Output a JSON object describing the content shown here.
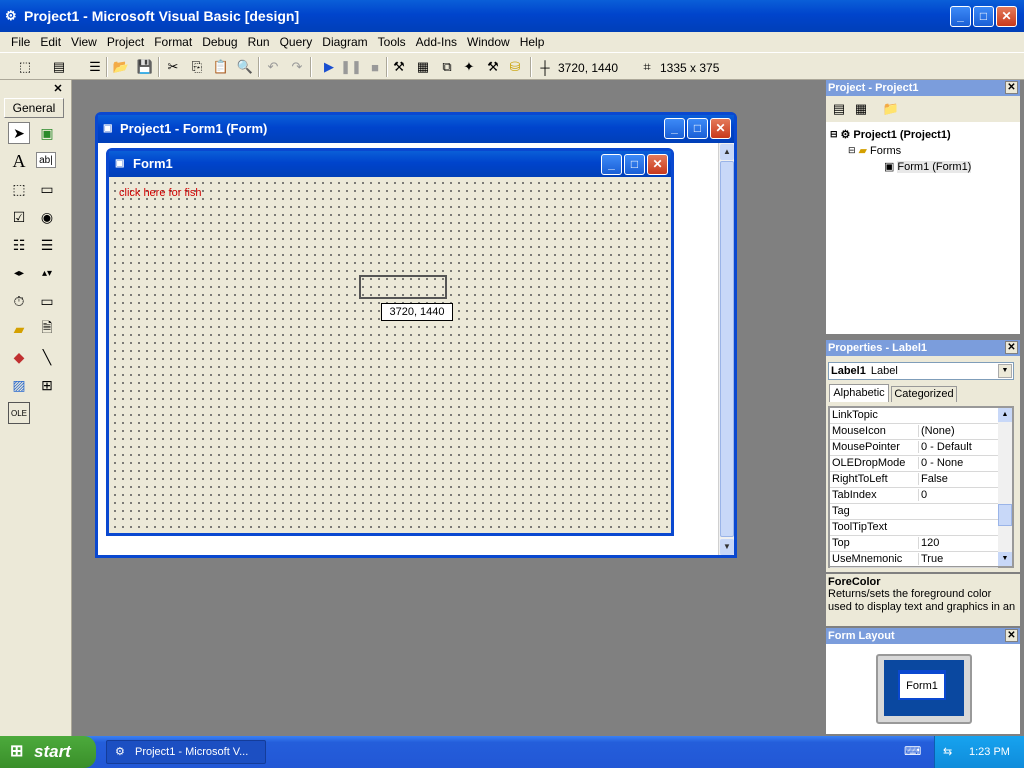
{
  "window": {
    "title": "Project1 - Microsoft Visual Basic [design]"
  },
  "menu": [
    "File",
    "Edit",
    "View",
    "Project",
    "Format",
    "Debug",
    "Run",
    "Query",
    "Diagram",
    "Tools",
    "Add-Ins",
    "Window",
    "Help"
  ],
  "toolbar": {
    "position_readout": "3720, 1440",
    "size_readout": "1335 x 375"
  },
  "toolbox": {
    "tab_label": "General",
    "close_glyph": "✕"
  },
  "designer": {
    "title": "Project1 - Form1 (Form)"
  },
  "form": {
    "title": "Form1",
    "label_text": "click here for fish",
    "label_color": "#d00000",
    "tooltip": "3720, 1440"
  },
  "project_pane": {
    "title": "Project - Project1",
    "tree": {
      "project": "Project1 (Project1)",
      "folder": "Forms",
      "form": "Form1 (Form1)"
    }
  },
  "properties_pane": {
    "title": "Properties - Label1",
    "object_name": "Label1",
    "object_type": "Label",
    "tabs": [
      "Alphabetic",
      "Categorized"
    ],
    "rows": [
      {
        "name": "LinkTopic",
        "value": ""
      },
      {
        "name": "MouseIcon",
        "value": "(None)"
      },
      {
        "name": "MousePointer",
        "value": "0 - Default"
      },
      {
        "name": "OLEDropMode",
        "value": "0 - None"
      },
      {
        "name": "RightToLeft",
        "value": "False"
      },
      {
        "name": "TabIndex",
        "value": "0"
      },
      {
        "name": "Tag",
        "value": ""
      },
      {
        "name": "ToolTipText",
        "value": ""
      },
      {
        "name": "Top",
        "value": "120"
      },
      {
        "name": "UseMnemonic",
        "value": "True"
      }
    ],
    "desc_title": "ForeColor",
    "desc_text": "Returns/sets the foreground color used to display text and graphics in an"
  },
  "layout_pane": {
    "title": "Form Layout",
    "form_label": "Form1"
  },
  "taskbar": {
    "start_label": "start",
    "task_label": "Project1 - Microsoft V...",
    "clock": "1:23 PM"
  }
}
